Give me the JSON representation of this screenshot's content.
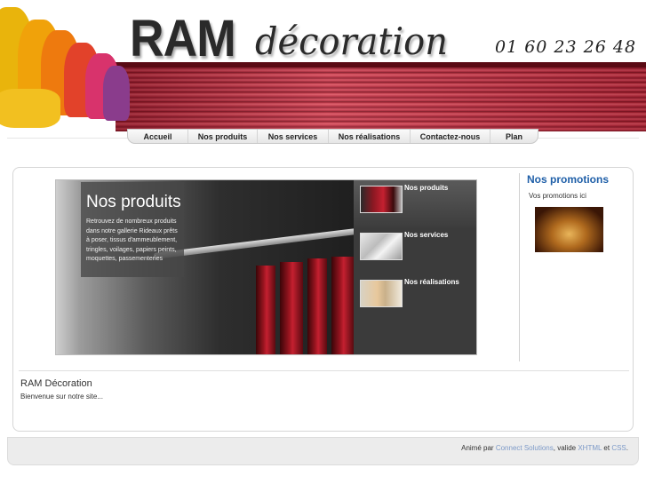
{
  "header": {
    "brand": "RAM",
    "brand_script": "décoration",
    "phone": "01 60 23 26 48"
  },
  "nav": {
    "items": [
      {
        "label": "Accueil"
      },
      {
        "label": "Nos produits"
      },
      {
        "label": "Nos services"
      },
      {
        "label": "Nos réalisations"
      },
      {
        "label": "Contactez-nous"
      },
      {
        "label": "Plan"
      }
    ]
  },
  "slideshow": {
    "caption_title": "Nos produits",
    "caption_text": "Retrouvez de nombreux produits dans notre gallerie Rideaux prêts à poser, tissus d'ammeublement, tringles, voilages, papiers peints, moquettes, passementeries",
    "thumbs": [
      {
        "label": "Nos produits",
        "active": true
      },
      {
        "label": "Nos services",
        "active": false
      },
      {
        "label": "Nos réalisations",
        "active": false
      }
    ]
  },
  "sidebar": {
    "title": "Nos promotions",
    "text": "Vos promotions ici"
  },
  "content": {
    "title": "RAM Décoration",
    "text": "Bienvenue sur notre site..."
  },
  "footer": {
    "prefix": "Animé par",
    "link1": "Connect Solutions",
    "middle": ", valide",
    "link2": "XHTML",
    "and": "et",
    "link3": "CSS",
    "end": "."
  },
  "colors": {
    "accent_blue": "#1f5fa8",
    "link": "#7d9ac8",
    "curtain_red": "#b82a3a"
  }
}
